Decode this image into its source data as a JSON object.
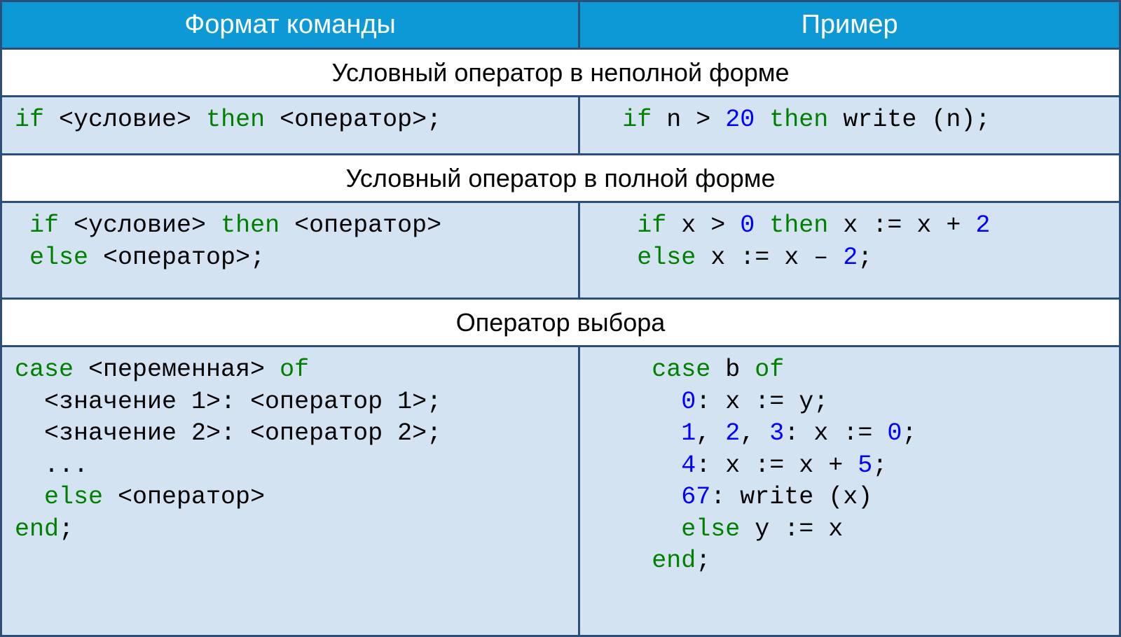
{
  "columns": {
    "format": "Формат команды",
    "example": "Пример"
  },
  "sections": [
    {
      "title": "Условный оператор в неполной форме",
      "format_code": [
        {
          "type": "kw",
          "t": "if"
        },
        {
          "type": "plain",
          "t": " <условие> "
        },
        {
          "type": "kw",
          "t": "then"
        },
        {
          "type": "plain",
          "t": " <оператор>;"
        }
      ],
      "example_code": [
        {
          "type": "plain",
          "t": "  "
        },
        {
          "type": "kw",
          "t": "if"
        },
        {
          "type": "plain",
          "t": " n > "
        },
        {
          "type": "num",
          "t": "20"
        },
        {
          "type": "plain",
          "t": " "
        },
        {
          "type": "kw",
          "t": "then"
        },
        {
          "type": "plain",
          "t": " write (n);"
        }
      ]
    },
    {
      "title": "Условный оператор в полной форме",
      "format_code": [
        {
          "type": "plain",
          "t": " "
        },
        {
          "type": "kw",
          "t": "if"
        },
        {
          "type": "plain",
          "t": " <условие> "
        },
        {
          "type": "kw",
          "t": "then"
        },
        {
          "type": "plain",
          "t": " <оператор>"
        },
        {
          "type": "br"
        },
        {
          "type": "plain",
          "t": " "
        },
        {
          "type": "kw",
          "t": "else"
        },
        {
          "type": "plain",
          "t": " <оператор>;"
        }
      ],
      "example_code": [
        {
          "type": "plain",
          "t": "   "
        },
        {
          "type": "kw",
          "t": "if"
        },
        {
          "type": "plain",
          "t": " x > "
        },
        {
          "type": "num",
          "t": "0"
        },
        {
          "type": "plain",
          "t": " "
        },
        {
          "type": "kw",
          "t": "then"
        },
        {
          "type": "plain",
          "t": " x := x + "
        },
        {
          "type": "num",
          "t": "2"
        },
        {
          "type": "br"
        },
        {
          "type": "plain",
          "t": "   "
        },
        {
          "type": "kw",
          "t": "else"
        },
        {
          "type": "plain",
          "t": " x := x – "
        },
        {
          "type": "num",
          "t": "2"
        },
        {
          "type": "plain",
          "t": ";"
        }
      ]
    },
    {
      "title": "Оператор выбора",
      "format_code": [
        {
          "type": "kw",
          "t": "case"
        },
        {
          "type": "plain",
          "t": " <переменная> "
        },
        {
          "type": "kw",
          "t": "of"
        },
        {
          "type": "br"
        },
        {
          "type": "plain",
          "t": "  <значение 1>: <оператор 1>;"
        },
        {
          "type": "br"
        },
        {
          "type": "plain",
          "t": "  <значение 2>: <оператор 2>;"
        },
        {
          "type": "br"
        },
        {
          "type": "plain",
          "t": "  ..."
        },
        {
          "type": "br"
        },
        {
          "type": "plain",
          "t": "  "
        },
        {
          "type": "kw",
          "t": "else"
        },
        {
          "type": "plain",
          "t": " <оператор>"
        },
        {
          "type": "br"
        },
        {
          "type": "kw",
          "t": "end"
        },
        {
          "type": "plain",
          "t": ";"
        }
      ],
      "example_code": [
        {
          "type": "plain",
          "t": "    "
        },
        {
          "type": "kw",
          "t": "case"
        },
        {
          "type": "plain",
          "t": " b "
        },
        {
          "type": "kw",
          "t": "of"
        },
        {
          "type": "br"
        },
        {
          "type": "plain",
          "t": "      "
        },
        {
          "type": "num",
          "t": "0"
        },
        {
          "type": "plain",
          "t": ": x := y;"
        },
        {
          "type": "br"
        },
        {
          "type": "plain",
          "t": "      "
        },
        {
          "type": "num",
          "t": "1"
        },
        {
          "type": "plain",
          "t": ", "
        },
        {
          "type": "num",
          "t": "2"
        },
        {
          "type": "plain",
          "t": ", "
        },
        {
          "type": "num",
          "t": "3"
        },
        {
          "type": "plain",
          "t": ": x := "
        },
        {
          "type": "num",
          "t": "0"
        },
        {
          "type": "plain",
          "t": ";"
        },
        {
          "type": "br"
        },
        {
          "type": "plain",
          "t": "      "
        },
        {
          "type": "num",
          "t": "4"
        },
        {
          "type": "plain",
          "t": ": x := x + "
        },
        {
          "type": "num",
          "t": "5"
        },
        {
          "type": "plain",
          "t": ";"
        },
        {
          "type": "br"
        },
        {
          "type": "plain",
          "t": "      "
        },
        {
          "type": "num",
          "t": "67"
        },
        {
          "type": "plain",
          "t": ": write (x)"
        },
        {
          "type": "br"
        },
        {
          "type": "plain",
          "t": "      "
        },
        {
          "type": "kw",
          "t": "else"
        },
        {
          "type": "plain",
          "t": " y := x"
        },
        {
          "type": "br"
        },
        {
          "type": "plain",
          "t": "    "
        },
        {
          "type": "kw",
          "t": "end"
        },
        {
          "type": "plain",
          "t": ";"
        }
      ]
    }
  ]
}
